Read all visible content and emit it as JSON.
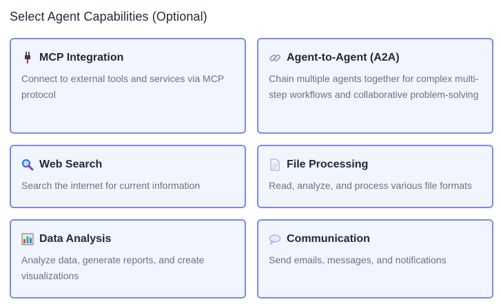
{
  "heading": "Select Agent Capabilities (Optional)",
  "capabilities": [
    {
      "icon": "plug-icon",
      "title": "MCP Integration",
      "description": "Connect to external tools and services via MCP protocol"
    },
    {
      "icon": "link-icon",
      "title": "Agent-to-Agent (A2A)",
      "description": "Chain multiple agents together for complex multi-step workflows and collaborative problem-solving"
    },
    {
      "icon": "magnifier-icon",
      "title": "Web Search",
      "description": "Search the internet for current information"
    },
    {
      "icon": "document-icon",
      "title": "File Processing",
      "description": "Read, analyze, and process various file formats"
    },
    {
      "icon": "bar-chart-icon",
      "title": "Data Analysis",
      "description": "Analyze data, generate reports, and create visualizations"
    },
    {
      "icon": "speech-bubble-icon",
      "title": "Communication",
      "description": "Send emails, messages, and notifications"
    }
  ],
  "colors": {
    "card_bg": "#f0f5ff",
    "card_border": "#7c89e6",
    "title_text": "#1f2937",
    "desc_text": "#6b7280"
  }
}
